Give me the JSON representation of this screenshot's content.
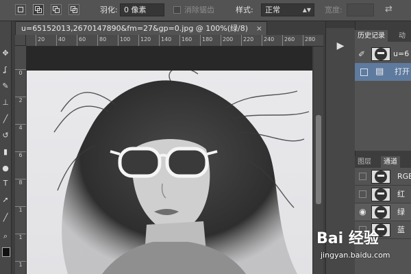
{
  "options_bar": {
    "feather_label": "羽化:",
    "feather_value": "0 像素",
    "antialias_label": "消除锯齿",
    "style_label": "样式:",
    "style_value": "正常",
    "width_label": "宽度:"
  },
  "document": {
    "tab_title": "u=65152013,2670147890&fm=27&gp=0.jpg @ 100%(绿/8)",
    "close_glyph": "×"
  },
  "ruler": {
    "h_ticks": [
      "20",
      "40",
      "60",
      "80",
      "100",
      "120",
      "140",
      "160",
      "180",
      "200",
      "220",
      "240",
      "260",
      "280",
      "300"
    ],
    "v_ticks": [
      "0",
      "2",
      "4",
      "6",
      "8",
      "1",
      "1",
      "1"
    ]
  },
  "history_panel": {
    "tabs": [
      "历史记录",
      "动"
    ],
    "snapshot_label": "u=6",
    "step_label": "打开"
  },
  "channels_panel": {
    "tabs": [
      "图层",
      "通道"
    ],
    "channels": [
      {
        "label": "RGB",
        "visible": false
      },
      {
        "label": "红",
        "visible": false
      },
      {
        "label": "绿",
        "visible": true
      },
      {
        "label": "蓝",
        "visible": false
      }
    ]
  },
  "watermark": {
    "logo": "Bai 经验",
    "url": "jingyan.baidu.com"
  },
  "colors": {
    "selection": "#5e7a9e",
    "panel_bg": "#535353"
  }
}
